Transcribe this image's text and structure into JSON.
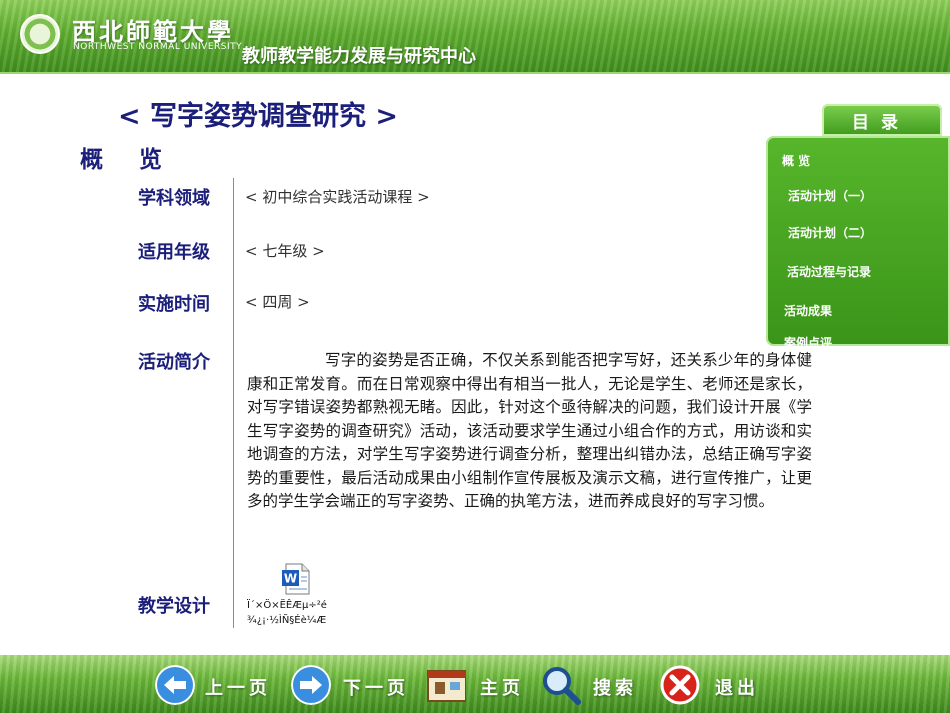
{
  "header": {
    "university_cn": "西北師範大學",
    "university_en": "NORTHWEST NORMAL UNIVERSITY",
    "center_name": "教师教学能力发展与研究中心"
  },
  "title": "< 写字姿势调查研究 >",
  "overview_heading": "概 览",
  "fields": {
    "subject_label": "学科领域",
    "subject_value": "< 初中综合实践活动课程 >",
    "grade_label": "适用年级",
    "grade_value": "< 七年级 >",
    "time_label": "实施时间",
    "time_value": "< 四周 >",
    "intro_label": "活动简介",
    "intro_text": "写字的姿势是否正确，不仅关系到能否把字写好，还关系少年的身体健康和正常发育。而在日常观察中得出有相当一批人，无论是学生、老师还是家长，对写字错误姿势都熟视无睹。因此，针对这个亟待解决的问题，我们设计开展《学生写字姿势的调查研究》活动，该活动要求学生通过小组合作的方式，用访谈和实地调查的方法，对学生写字姿势进行调查分析，整理出纠错办法，总结正确写字姿势的重要性，最后活动成果由小组制作宣传展板及演示文稿，进行宣传推广，让更多的学生学会端正的写字姿势、正确的执笔方法，进而养成良好的写字习惯。",
    "design_label": "教学设计",
    "doc_caption_line1": "Ï´×Ö×ËÊÆµ÷²é",
    "doc_caption_line2": "¾¿¡·½ÌÑ§Éè¼Æ"
  },
  "toc": {
    "tab_label": "目录",
    "items": [
      "概 览",
      "活动计划（一）",
      "活动计划（二）",
      "活动过程与记录",
      "活动成果",
      "案例点评"
    ]
  },
  "nav": {
    "prev": "上一页",
    "next": "下一页",
    "home": "主页",
    "search": "搜索",
    "exit": "退出"
  },
  "colors": {
    "title": "#1b1f7a",
    "grass": "#5fae2f",
    "toc_panel": "#4aa622"
  }
}
